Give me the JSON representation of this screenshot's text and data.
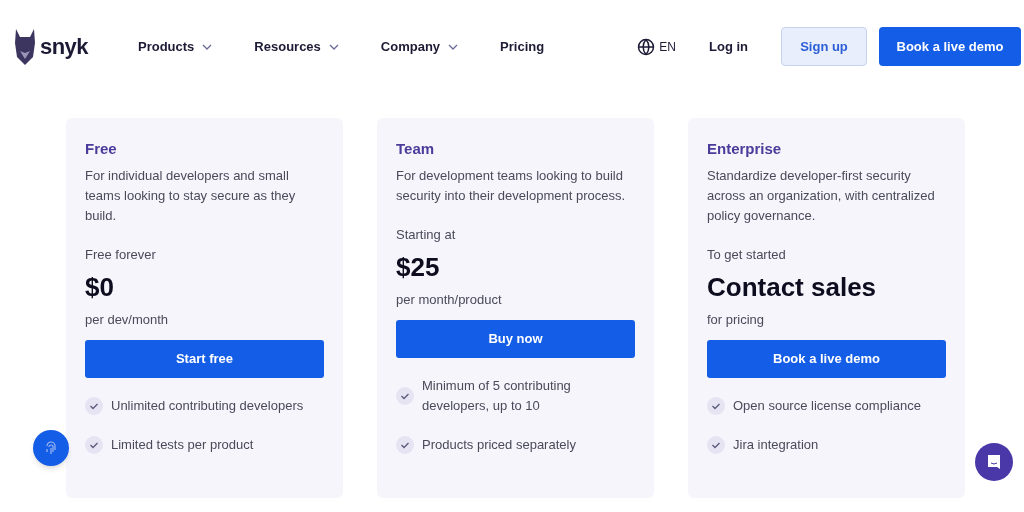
{
  "nav": {
    "logo": "snyk",
    "menu": [
      {
        "label": "Products",
        "dropdown": true
      },
      {
        "label": "Resources",
        "dropdown": true
      },
      {
        "label": "Company",
        "dropdown": true
      },
      {
        "label": "Pricing",
        "dropdown": false
      }
    ],
    "language": "EN",
    "login": "Log in",
    "signup": "Sign up",
    "demo": "Book a live demo"
  },
  "plans": [
    {
      "name": "Free",
      "description": "For individual developers and small teams looking to stay secure as they build.",
      "price_label": "Free forever",
      "price": "$0",
      "price_note": "per dev/month",
      "button": "Start free",
      "features": [
        "Unlimited contributing developers",
        "Limited tests per product"
      ]
    },
    {
      "name": "Team",
      "description": "For development teams looking to build security into their development process.",
      "price_label": "Starting at",
      "price": "$25",
      "price_note": "per month/product",
      "button": "Buy now",
      "features": [
        "Minimum of 5 contributing developers, up to 10",
        "Products priced separately"
      ]
    },
    {
      "name": "Enterprise",
      "description": "Standardize developer-first security across an organization, with centralized policy governance.",
      "price_label": "To get started",
      "price": "Contact sales",
      "price_note": "for pricing",
      "button": "Book a live demo",
      "features": [
        "Open source license compliance",
        "Jira integration"
      ]
    }
  ]
}
